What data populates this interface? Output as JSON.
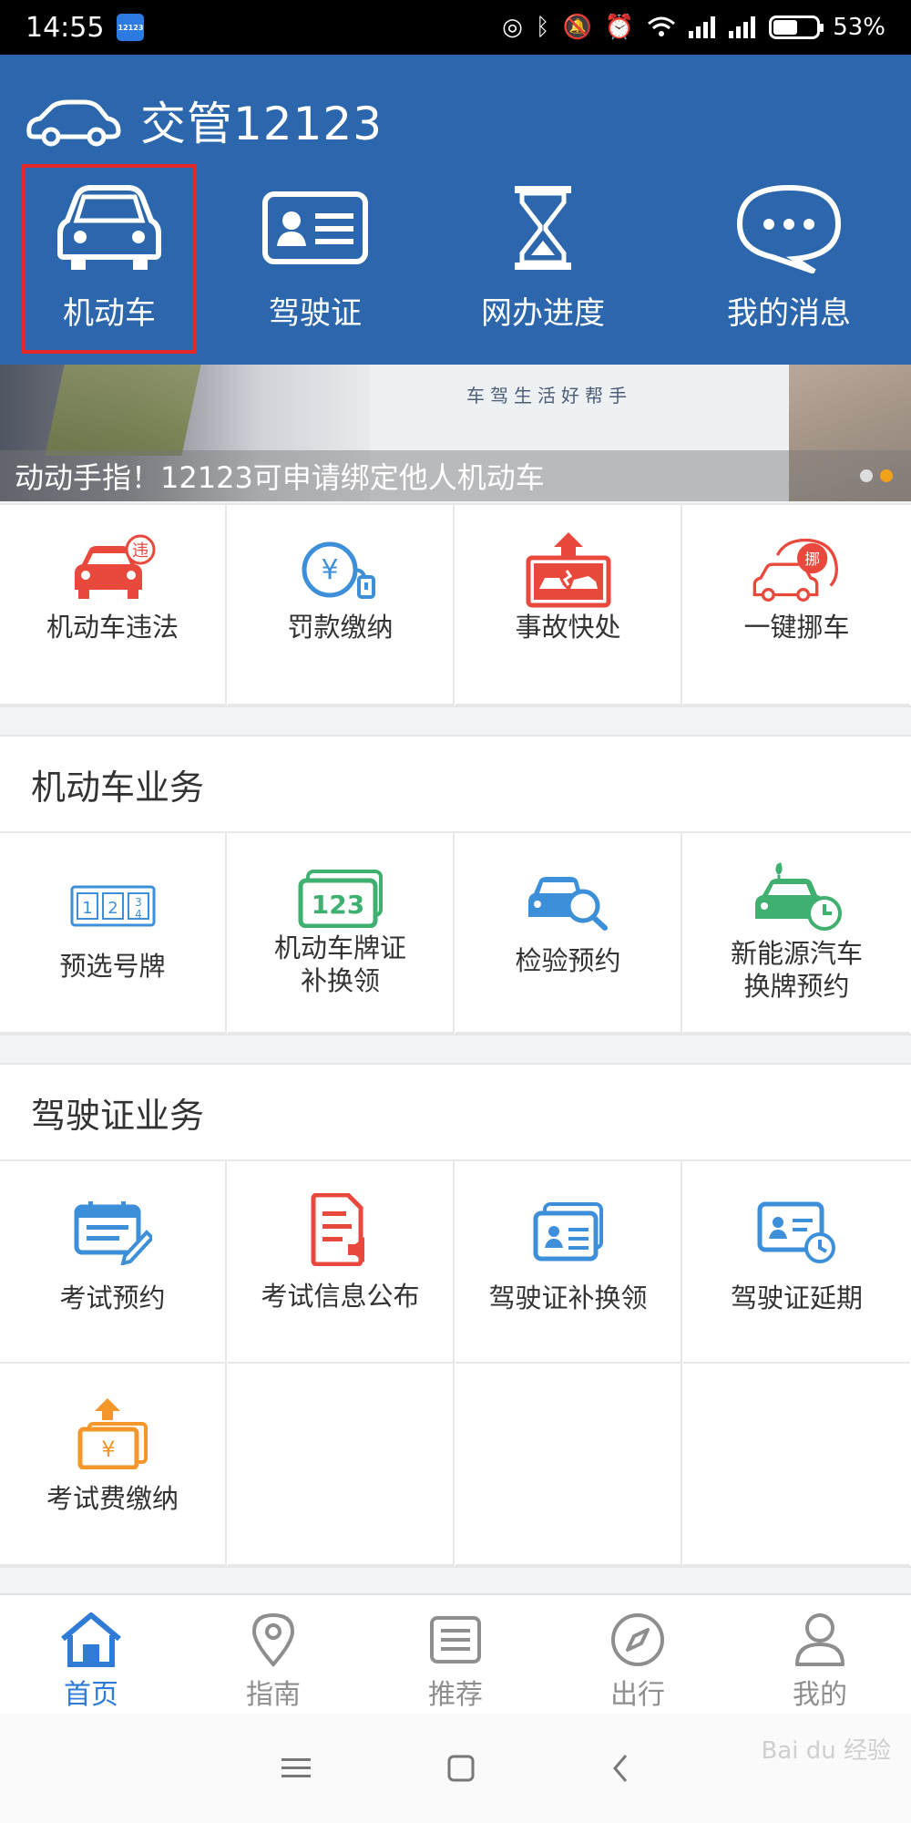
{
  "status_bar": {
    "time": "14:55",
    "app_icon_text": "12123",
    "battery": "53%"
  },
  "header": {
    "app_title": "交管12123"
  },
  "quick_nav": [
    {
      "label": "机动车",
      "icon": "car-icon"
    },
    {
      "label": "驾驶证",
      "icon": "id-card-icon"
    },
    {
      "label": "网办进度",
      "icon": "hourglass-icon"
    },
    {
      "label": "我的消息",
      "icon": "chat-bubble-icon"
    }
  ],
  "banner": {
    "caption": "动动手指！12123可申请绑定他人机动车",
    "slogan": "车驾生活好帮手"
  },
  "top_services": [
    {
      "label": "机动车违法",
      "icon": "car-violation-icon",
      "badge": "违"
    },
    {
      "label": "罚款缴纳",
      "icon": "fine-payment-icon",
      "badge": "¥"
    },
    {
      "label": "事故快处",
      "icon": "accident-icon"
    },
    {
      "label": "一键挪车",
      "icon": "move-car-icon",
      "badge": "挪"
    }
  ],
  "vehicle_section": {
    "title": "机动车业务",
    "items": [
      {
        "label": "预选号牌",
        "icon": "plate-select-icon"
      },
      {
        "label": "机动车牌证\n补换领",
        "icon": "plate-replace-icon",
        "badge": "123"
      },
      {
        "label": "检验预约",
        "icon": "inspection-icon"
      },
      {
        "label": "新能源汽车\n换牌预约",
        "icon": "new-energy-car-icon"
      }
    ]
  },
  "license_section": {
    "title": "驾驶证业务",
    "items": [
      {
        "label": "考试预约",
        "icon": "exam-booking-icon"
      },
      {
        "label": "考试信息公布",
        "icon": "exam-info-icon"
      },
      {
        "label": "驾驶证补换领",
        "icon": "license-replace-icon"
      },
      {
        "label": "驾驶证延期",
        "icon": "license-extend-icon"
      },
      {
        "label": "考试费缴纳",
        "icon": "exam-fee-icon",
        "badge": "¥"
      }
    ]
  },
  "tab_bar": [
    {
      "label": "首页",
      "icon": "home-icon",
      "active": true
    },
    {
      "label": "指南",
      "icon": "location-pin-icon"
    },
    {
      "label": "推荐",
      "icon": "list-icon"
    },
    {
      "label": "出行",
      "icon": "compass-icon"
    },
    {
      "label": "我的",
      "icon": "user-icon"
    }
  ],
  "watermark": "Bai du 经验",
  "colors": {
    "header_blue": "#2c67ad",
    "active_tab": "#2f7bd6",
    "highlight_red": "#e5262a",
    "icon_red": "#e9493d",
    "icon_blue": "#3e8fd9",
    "icon_green": "#3fb06f",
    "icon_orange": "#f4962a"
  }
}
